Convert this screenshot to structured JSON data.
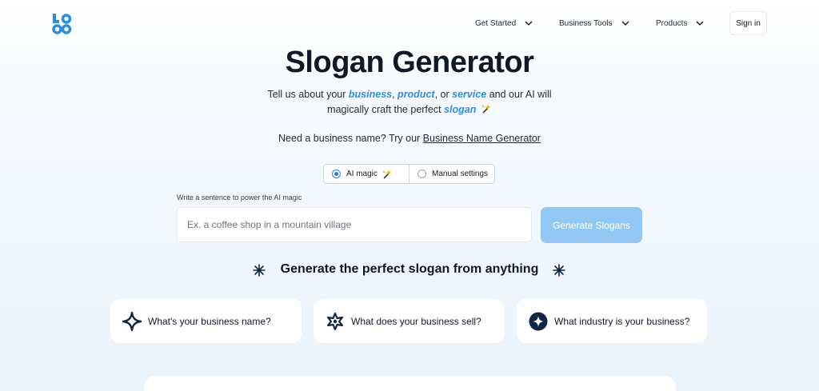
{
  "nav": {
    "logo_text": "LOGO",
    "items": [
      {
        "label": "Get Started"
      },
      {
        "label": "Business Tools"
      },
      {
        "label": "Products"
      }
    ],
    "signin_label": "Sign in"
  },
  "hero": {
    "title": "Slogan Generator",
    "line1_prefix": "Tell us about your ",
    "kw_business": "business",
    "sep1": ", ",
    "kw_product": "product",
    "sep2": ", or ",
    "kw_service": "service",
    "line1_suffix": " and our AI will",
    "line2_prefix": "magically craft the perfect ",
    "kw_slogan": "slogan",
    "name_prompt": "Need a business name? Try our ",
    "name_link": "Business Name Generator"
  },
  "mode": {
    "options": [
      {
        "label": "AI magic",
        "selected": true
      },
      {
        "label": "Manual settings",
        "selected": false
      }
    ]
  },
  "form": {
    "label": "Write a sentence to power the AI magic",
    "value": "",
    "placeholder": "Ex. a coffee shop in a mountain village",
    "button_label": "Generate Slogans"
  },
  "section": {
    "title": "Generate the perfect slogan from anything"
  },
  "cards": [
    {
      "label": "What's your business name?",
      "icon": "diamond-sparkle-icon"
    },
    {
      "label": "What does your business sell?",
      "icon": "flower-icon"
    },
    {
      "label": "What industry is your business?",
      "icon": "sparkle-circle-icon"
    }
  ],
  "colors": {
    "accent": "#2b8fe0",
    "button": "#93c8f5",
    "dark": "#0f2742",
    "text": "#111827"
  }
}
